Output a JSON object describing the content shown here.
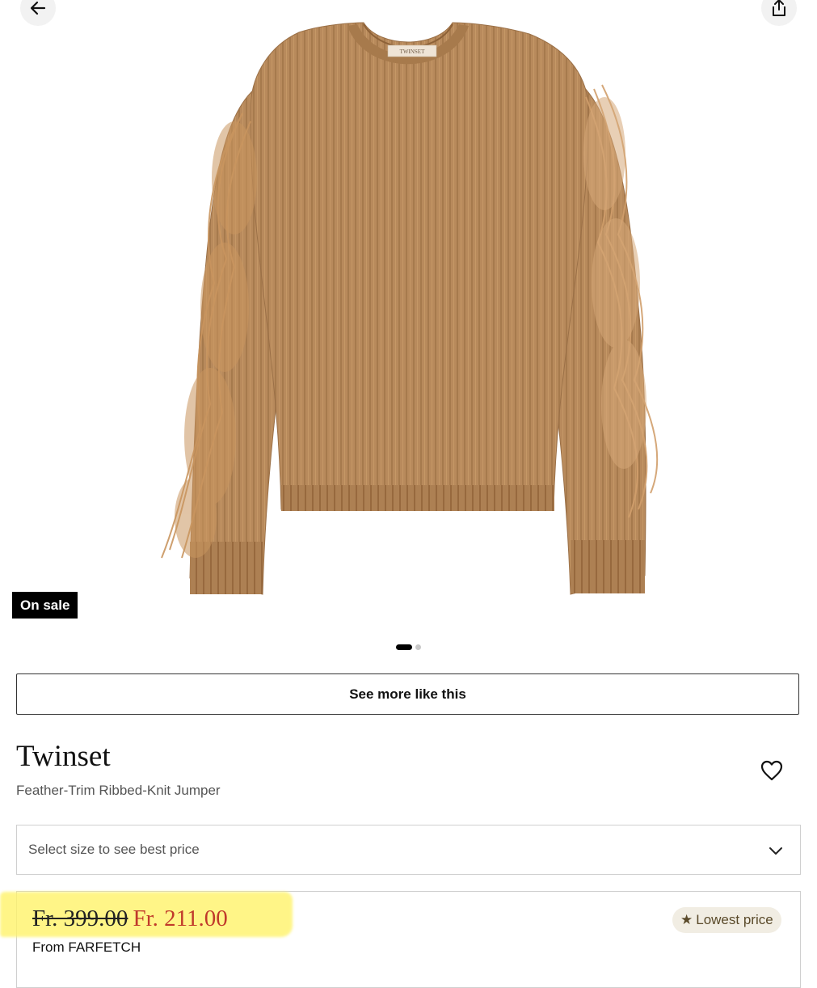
{
  "header": {
    "back_icon": "arrow-left-icon",
    "share_icon": "share-icon"
  },
  "gallery": {
    "image_subject": "camel ribbed-knit jumper with feather trim sleeves",
    "label_text": "TWINSET",
    "badge": "On sale",
    "total_images": 2,
    "active_index": 1
  },
  "actions": {
    "see_more_label": "See more like this"
  },
  "product": {
    "brand": "Twinset",
    "name": "Feather-Trim Ribbed-Knit Jumper",
    "wishlist_icon": "heart-icon"
  },
  "size_select": {
    "placeholder": "Select size to see best price",
    "icon": "chevron-down-icon"
  },
  "offer": {
    "old_price": "Fr. 399.00",
    "new_price": "Fr. 211.00",
    "retailer": "From FARFETCH",
    "badge_star": "★",
    "badge_label": "Lowest price"
  },
  "colors": {
    "sale_price": "#c0392b",
    "highlight": "#fff36a",
    "badge_bg": "#f1ede3",
    "sweater": "#b88a5c"
  }
}
